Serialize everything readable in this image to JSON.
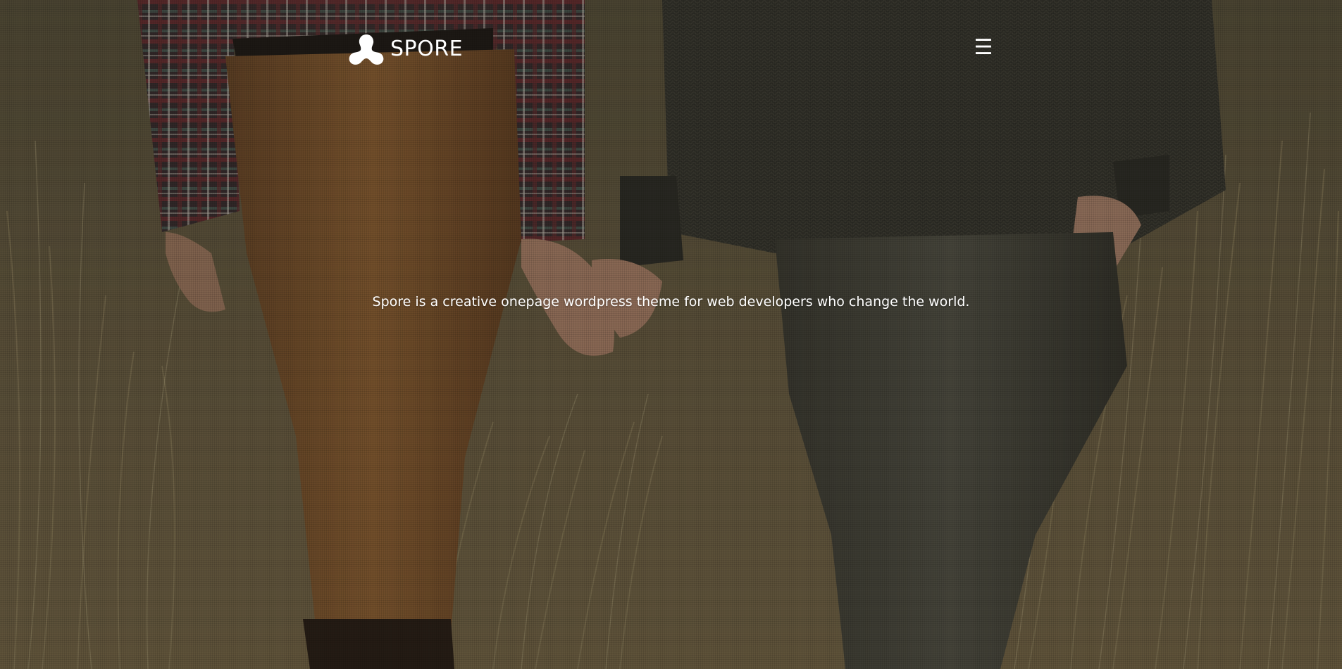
{
  "header": {
    "brand": "SPORE",
    "logo_icon": "spore-logo-icon",
    "menu_icon": "hamburger-menu-icon",
    "menu_glyph": "☰"
  },
  "hero": {
    "tagline": "Spore is a creative onepage wordpress theme for web developers who change the world.",
    "background_description_colors": {
      "grass": "#8a7a55",
      "left_pants": "#9a6a3c",
      "right_pants": "#4a4a40",
      "sweater": "#3a3a34",
      "plaid_shirt": "#6a3a3a"
    },
    "text_color": "#ffffff"
  }
}
